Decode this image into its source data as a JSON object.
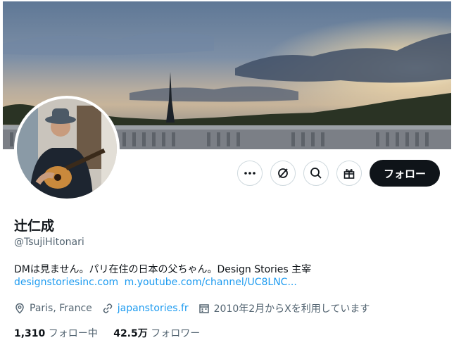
{
  "profile": {
    "name": "辻仁成",
    "handle": "@TsujiHitonari",
    "bio": "DMは見ません。パリ在住の日本の父ちゃん。Design Stories 主宰",
    "links": [
      "designstoriesinc.com",
      "m.youtube.com/channel/UC8LNC..."
    ],
    "location": "Paris, France",
    "website": "japanstories.fr",
    "joined": "2010年2月からXを利用しています"
  },
  "actions": {
    "more_icon": "more-icon",
    "grok_icon": "grok-icon",
    "search_icon": "search-icon",
    "gift_icon": "gift-icon",
    "follow_label": "フォロー"
  },
  "stats": {
    "following_count": "1,310",
    "following_label": "フォロー中",
    "followers_count": "42.5万",
    "followers_label": "フォロワー"
  },
  "colors": {
    "accent": "#1d9bf0",
    "text": "#0f1419",
    "secondary": "#536471",
    "button": "#0f1419"
  }
}
